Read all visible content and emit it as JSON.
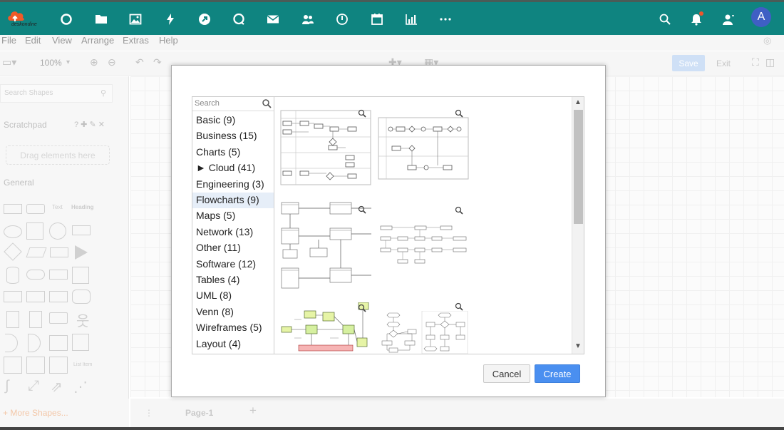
{
  "app": {
    "logo_text": "deskondine",
    "avatar_initial": "A",
    "colors": {
      "topbar": "#0f8480",
      "accent": "#4a8ff0",
      "notification": "#f0562c",
      "avatar": "#3f5fc4"
    },
    "nav_icons": [
      "circle-icon",
      "folder-icon",
      "image-icon",
      "bolt-icon",
      "rocket-icon",
      "chat-icon",
      "mail-icon",
      "users-icon",
      "clock-icon",
      "calendar-icon",
      "chart-icon",
      "more-icon"
    ],
    "right_icons": [
      "search-icon",
      "bell-icon",
      "user-icon"
    ]
  },
  "menu": {
    "file": "File",
    "edit": "Edit",
    "view": "View",
    "arrange": "Arrange",
    "extras": "Extras",
    "help": "Help"
  },
  "toolbar": {
    "zoom": "100%",
    "save": "Save",
    "exit": "Exit"
  },
  "sidebar": {
    "search_placeholder": "Search Shapes",
    "scratchpad": "Scratchpad",
    "drag_hint": "Drag elements here",
    "general": "General",
    "text_shape": "Text",
    "heading_shape": "Heading",
    "more_shapes": "+ More Shapes...",
    "list_item": "List Item"
  },
  "pages": {
    "current": "Page-1",
    "add": "+"
  },
  "dialog": {
    "search_placeholder": "Search",
    "categories": [
      {
        "label": "Basic (9)"
      },
      {
        "label": "Business (15)"
      },
      {
        "label": "Charts (5)"
      },
      {
        "label": "► Cloud (41)"
      },
      {
        "label": "Engineering (3)"
      },
      {
        "label": "Flowcharts (9)"
      },
      {
        "label": "Maps (5)"
      },
      {
        "label": "Network (13)"
      },
      {
        "label": "Other (11)"
      },
      {
        "label": "Software (12)"
      },
      {
        "label": "Tables (4)"
      },
      {
        "label": "UML (8)"
      },
      {
        "label": "Venn (8)"
      },
      {
        "label": "Wireframes (5)"
      },
      {
        "label": "Layout (4)"
      }
    ],
    "selected_category": "Flowcharts (9)",
    "cancel": "Cancel",
    "create": "Create"
  }
}
